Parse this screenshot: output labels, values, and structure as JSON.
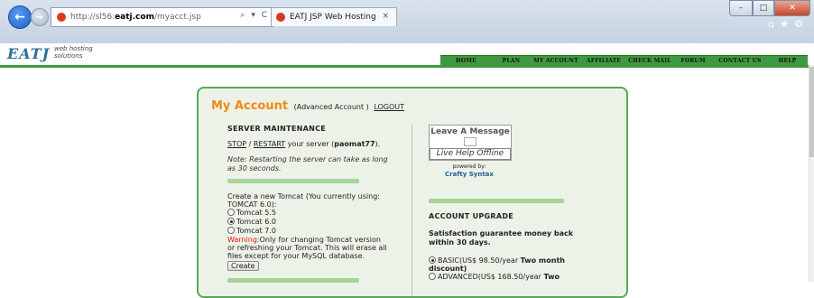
{
  "browser": {
    "url_prefix": "http://sl56.",
    "url_domain": "eatj.com",
    "url_path": "/myacct.jsp",
    "address_tools": "⌕ ▾ C",
    "tab_title": "EATJ JSP Web Hosting",
    "tab_close": "×"
  },
  "site": {
    "logo": "EATJ",
    "tagline_1": "web hosting",
    "tagline_2": "solutions",
    "nav": [
      "HOME",
      "PLAN",
      "MY ACCOUNT",
      "AFFILIATE",
      "CHECK MAIL",
      "FORUM",
      "CONTACT US",
      "HELP"
    ]
  },
  "account": {
    "title": "My Account",
    "account_type": "(Advanced Account )",
    "logout": "LOGOUT",
    "server": {
      "heading": "SERVER MAINTENANCE",
      "stop": "STOP",
      "slash": " / ",
      "restart": "RESTART",
      "server_text": " your server (",
      "server_name": "paomat77",
      "server_close": ").",
      "note": "Note: Restarting the server can take as long as 30 seconds."
    },
    "tomcat": {
      "intro": "Create a new Tomcat (You currently using: TOMCAT 6.0):",
      "options": [
        "Tomcat 5.5",
        "Tomcat 6.0",
        "Tomcat 7.0"
      ],
      "selected": "Tomcat 6.0",
      "warning_label": "Warning:",
      "warning_text": "Only for changing Tomcat version or refreshing your Tomcat. This will erase all files except for your MySQL database.",
      "create_button": "Create"
    },
    "chat": {
      "leave_message": "Leave A Message",
      "status": "Live Help Offline",
      "powered_by": "powered by:",
      "brand": "Crafty Syntax"
    },
    "upgrade": {
      "heading": "ACCOUNT UPGRADE",
      "guarantee": "Satisfaction guarantee money back within 30 days.",
      "basic_price": "BASIC(US$ 98.50/year ",
      "basic_bonus": "Two month",
      "basic_tail": "discount)",
      "advanced_price": "ADVANCED(US$ 168.50/year ",
      "advanced_bonus": "Two"
    }
  }
}
